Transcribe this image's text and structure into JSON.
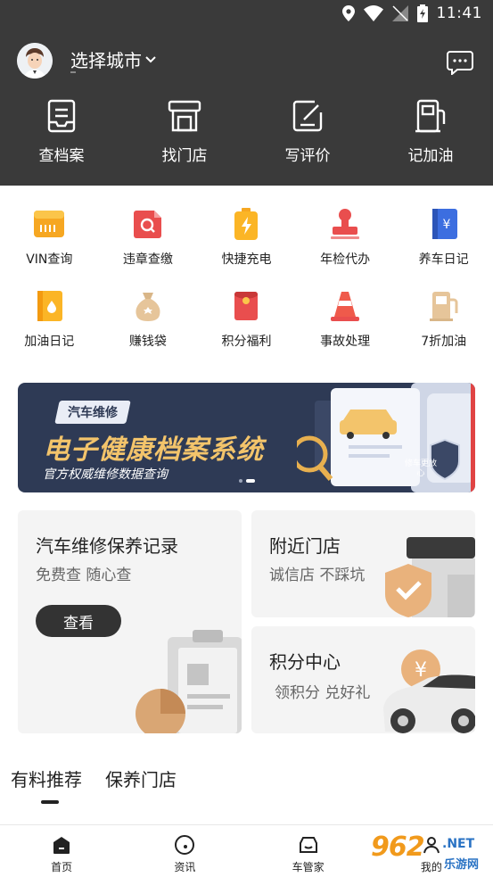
{
  "status_bar": {
    "time": "11:41"
  },
  "header": {
    "city": "选择城市",
    "quick_actions": [
      {
        "label": "查档案",
        "icon": "archive-icon"
      },
      {
        "label": "找门店",
        "icon": "store-icon"
      },
      {
        "label": "写评价",
        "icon": "edit-icon"
      },
      {
        "label": "记加油",
        "icon": "fuel-icon"
      }
    ]
  },
  "grid": {
    "items": [
      {
        "label": "VIN查询",
        "icon": "vin-card-icon"
      },
      {
        "label": "违章查缴",
        "icon": "violation-search-icon"
      },
      {
        "label": "快捷充电",
        "icon": "battery-charge-icon"
      },
      {
        "label": "年检代办",
        "icon": "stamp-icon"
      },
      {
        "label": "养车日记",
        "icon": "yen-book-icon"
      },
      {
        "label": "加油日记",
        "icon": "fuel-drop-book-icon"
      },
      {
        "label": "赚钱袋",
        "icon": "money-bag-icon"
      },
      {
        "label": "积分福利",
        "icon": "red-envelope-icon"
      },
      {
        "label": "事故处理",
        "icon": "traffic-cone-icon"
      },
      {
        "label": "7折加油",
        "icon": "gas-pump-icon"
      }
    ]
  },
  "banner": {
    "tag": "汽车维修",
    "title": "电子健康档案系统",
    "subtitle": "官方权威维修数据查询",
    "badge": "修车更放心",
    "active_slide": 2,
    "slide_count": 2
  },
  "cards": {
    "maintenance": {
      "title": "汽车维修保养记录",
      "subtitle": "免费查 随心查",
      "button": "查看"
    },
    "nearby": {
      "title": "附近门店",
      "subtitle": "诚信店 不踩坑"
    },
    "points": {
      "title": "积分中心",
      "subtitle": "领积分 兑好礼"
    }
  },
  "tabs": [
    {
      "label": "有料推荐",
      "active": true
    },
    {
      "label": "保养门店",
      "active": false
    }
  ],
  "bottom_nav": [
    {
      "label": "首页",
      "icon": "home-icon"
    },
    {
      "label": "资讯",
      "icon": "news-icon"
    },
    {
      "label": "车管家",
      "icon": "car-manager-icon"
    },
    {
      "label": "我的",
      "icon": "profile-icon"
    }
  ],
  "watermark": {
    "number": "962",
    "net": ".NET",
    "cn": "乐游网"
  },
  "colors": {
    "header_bg": "#3a3a3a",
    "accent_gold": "#f3c46b",
    "banner_bg": "#2e3a55",
    "button_dark": "#333333"
  }
}
